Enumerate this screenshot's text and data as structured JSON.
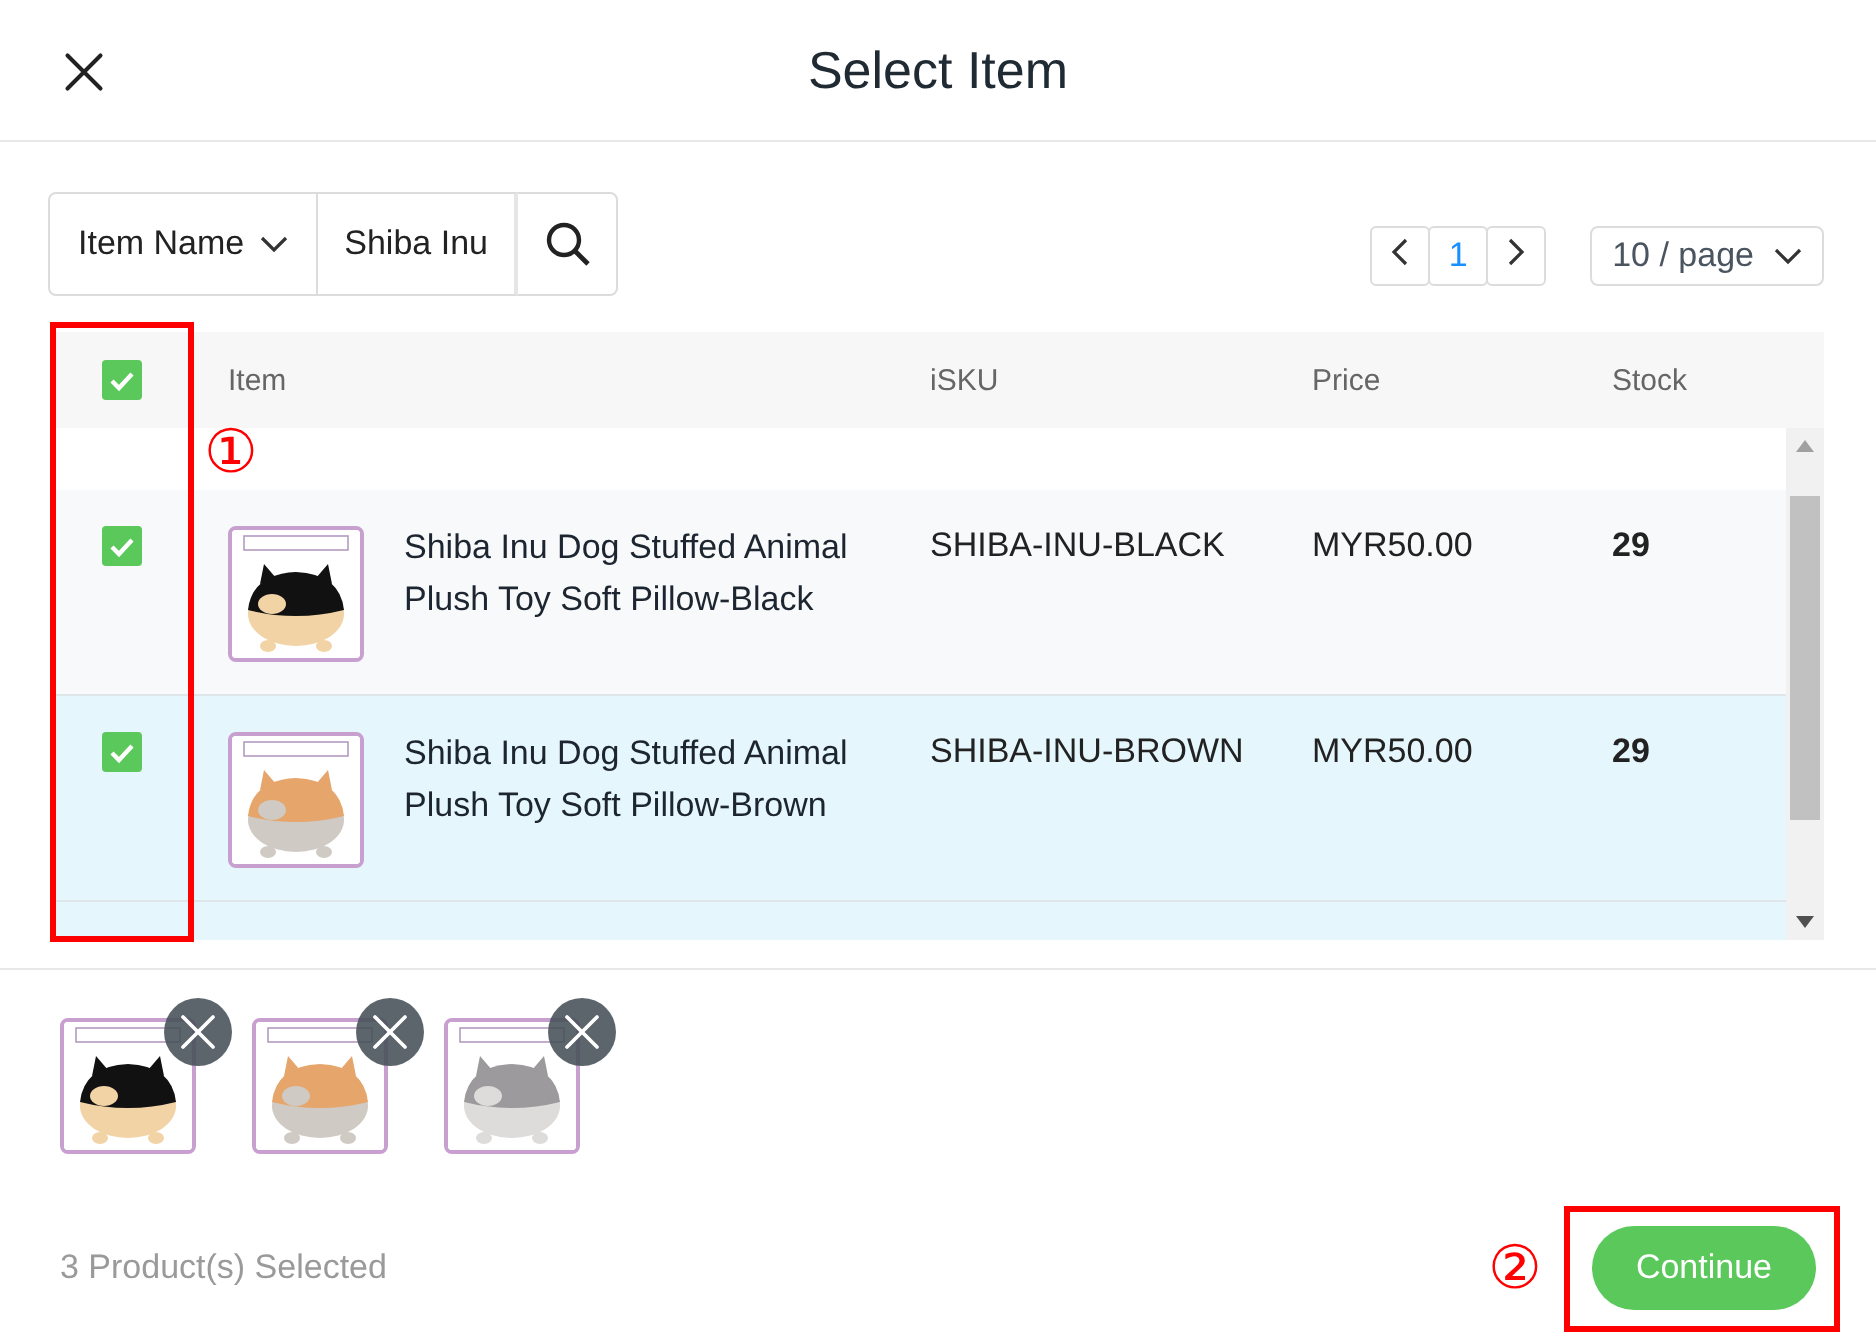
{
  "dialog": {
    "title": "Select Item"
  },
  "search": {
    "field_select": "Item Name",
    "value": "Shiba Inu"
  },
  "pagination": {
    "pages": [
      {
        "label": "1",
        "selected": true
      }
    ],
    "page_size": "10 / page"
  },
  "table": {
    "header_checked": true,
    "columns": [
      "Item",
      "iSKU",
      "Price",
      "Stock"
    ],
    "rows": [
      {
        "checked": true,
        "highlighted": false,
        "name": "Shiba Inu Dog Stuffed Animal Plush Toy Soft Pillow-Black",
        "sku": "SHIBA-INU-BLACK",
        "price": "MYR50.00",
        "stock": "29"
      },
      {
        "checked": true,
        "highlighted": true,
        "name": "Shiba Inu Dog Stuffed Animal Plush Toy Soft Pillow-Brown",
        "sku": "SHIBA-INU-BROWN",
        "price": "MYR50.00",
        "stock": "29"
      }
    ]
  },
  "footer": {
    "count": "3 Product(s) Selected",
    "button": "Continue"
  },
  "annotations": [
    {
      "label": "①"
    },
    {
      "label": "②"
    }
  ]
}
